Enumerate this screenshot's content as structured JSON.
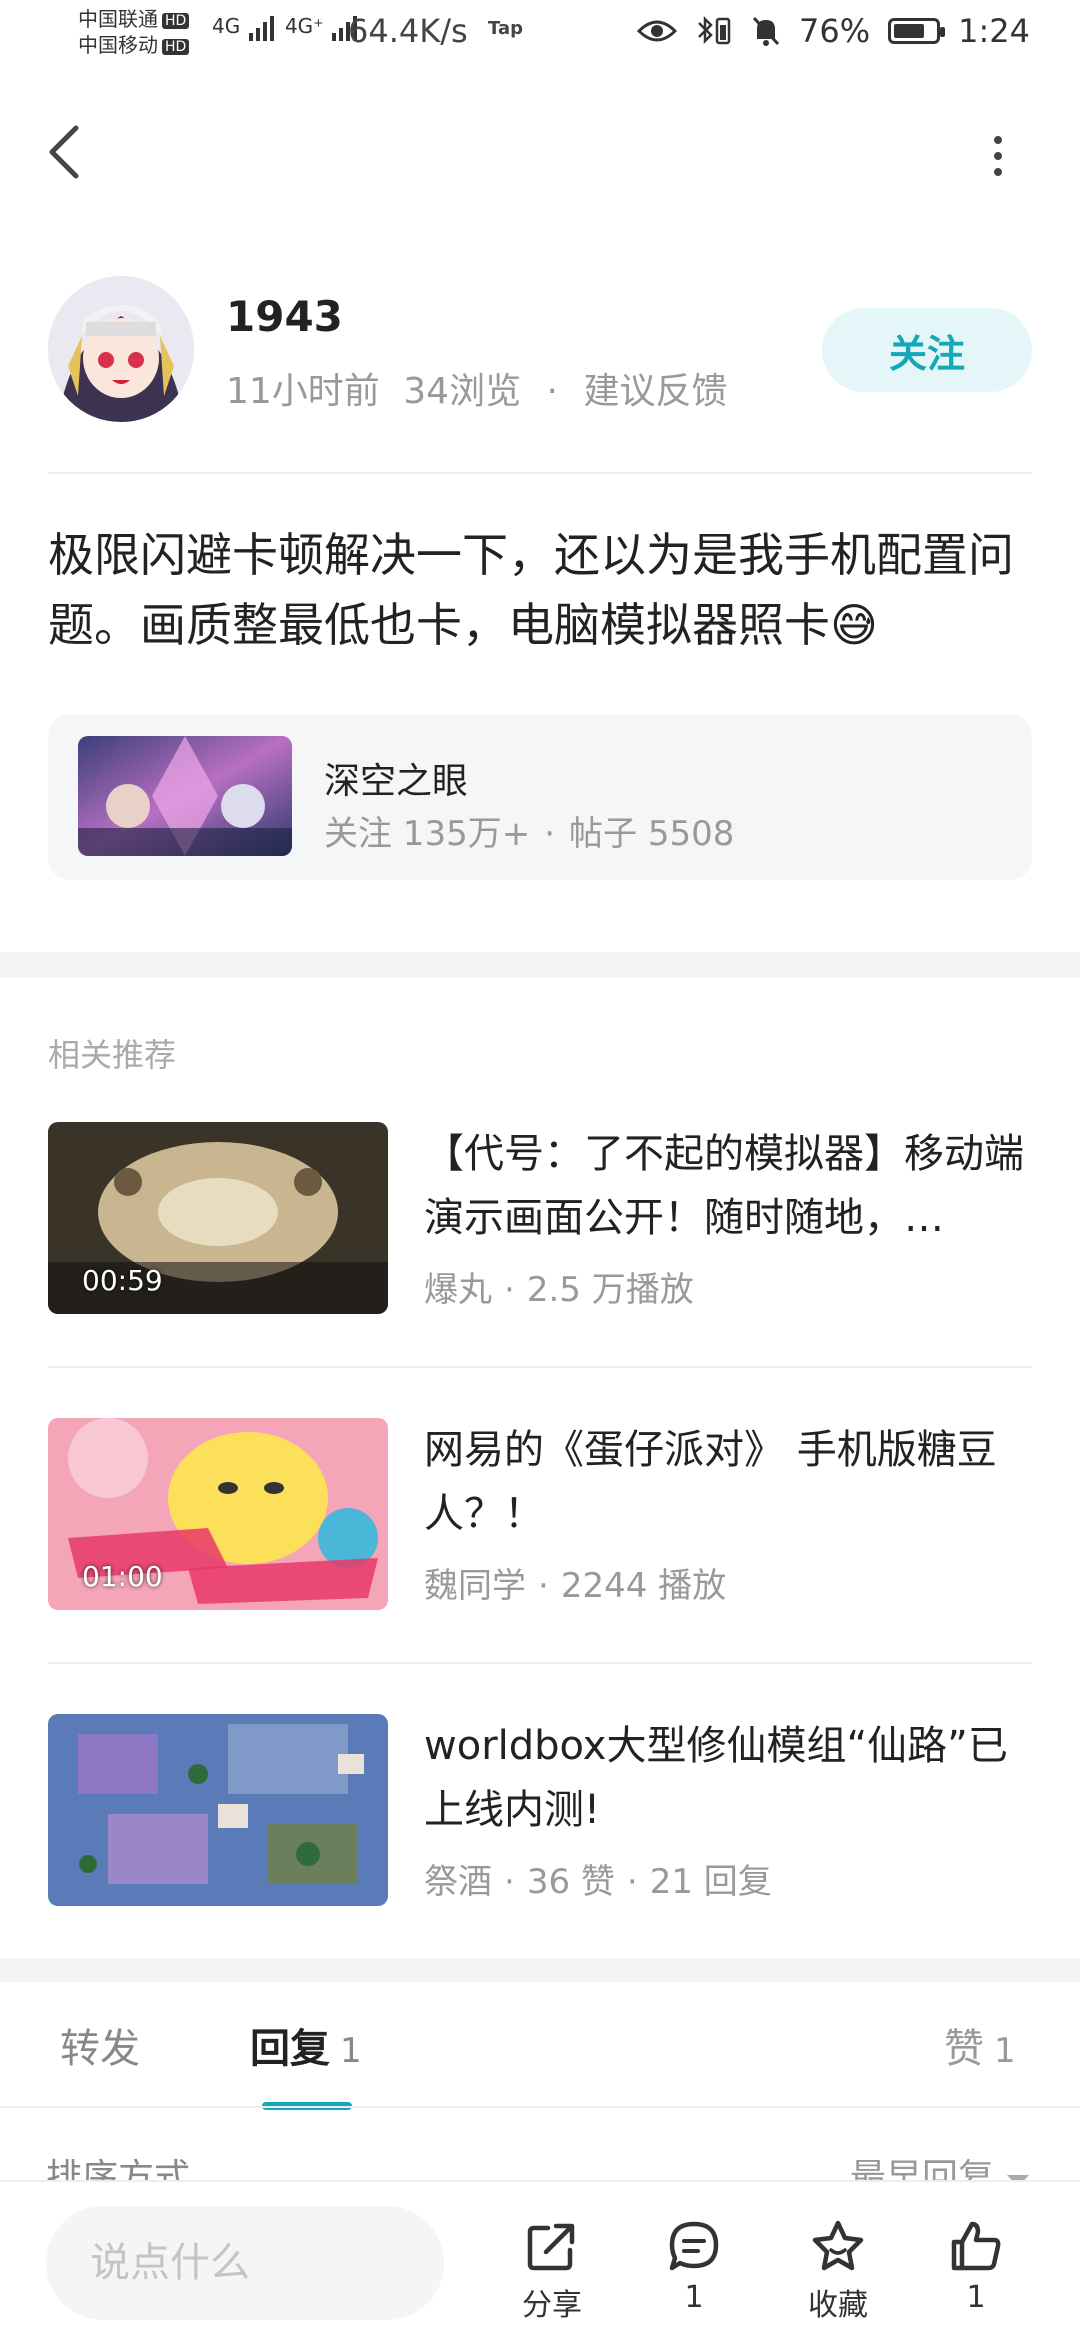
{
  "status_bar": {
    "carrier1": "中国联通",
    "carrier2": "中国移动",
    "hd": "HD",
    "net1": "4G",
    "net2": "4G⁺",
    "speed": "64.4K/s",
    "tap": "Tap",
    "battery": "76%",
    "battery_level": 0.76,
    "time": "1:24"
  },
  "author": {
    "name": "1943",
    "time_ago": "11小时前",
    "views": "34浏览",
    "feedback": "建议反馈",
    "follow_label": "关注"
  },
  "post": {
    "text": "极限闪避卡顿解决一下，还以为是我手机配置问题。画质整最低也卡，电脑模拟器照卡😅"
  },
  "game": {
    "name": "深空之眼",
    "followers": "关注 135万+",
    "posts": "帖子 5508"
  },
  "related": {
    "title": "相关推荐",
    "items": [
      {
        "title": "【代号：了不起的模拟器】移动端演示画面公开！随时随地，…",
        "author": "爆丸",
        "stats": "2.5 万播放",
        "duration": "00:59"
      },
      {
        "title": "网易的《蛋仔派对》 手机版糖豆人？！",
        "author": "魏同学",
        "stats": "2244 播放",
        "duration": "01:00"
      },
      {
        "title": "worldbox大型修仙模组“仙路”已上线内测!",
        "author": "祭酒",
        "stats": "36 赞",
        "stats2": "21 回复"
      }
    ]
  },
  "tabs": {
    "repost": "转发",
    "reply": "回复",
    "reply_count": "1",
    "likes": "赞",
    "likes_count": "1"
  },
  "sort": {
    "label": "排序方式",
    "value": "最早回复"
  },
  "bottom_bar": {
    "input_placeholder": "说点什么",
    "share": "分享",
    "comments": "1",
    "favorite": "收藏",
    "likes": "1"
  },
  "colors": {
    "accent": "#14a8b8",
    "follow_bg": "#e4f6f8"
  }
}
